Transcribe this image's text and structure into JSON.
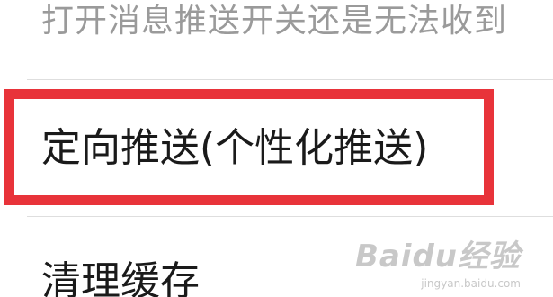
{
  "hint": {
    "text": "打开消息推送开关还是无法收到"
  },
  "settings": {
    "targeted_push": "定向推送(个性化推送)",
    "clear_cache": "清理缓存"
  },
  "highlight": {
    "color": "#e8333a"
  },
  "watermark": {
    "brand": "Baidu经验",
    "url": "jingyan.baidu.com"
  }
}
